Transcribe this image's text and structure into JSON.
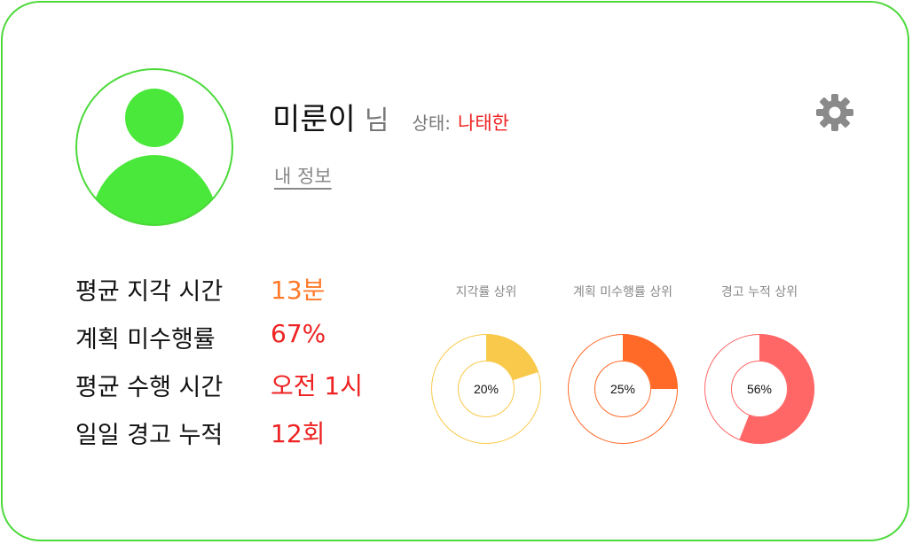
{
  "profile": {
    "name": "미룬이",
    "honorific": "님",
    "status_label": "상태:",
    "status_value": "나태한",
    "my_info_link": "내 정보",
    "avatar_icon": "user-silhouette-icon",
    "settings_icon": "gear-icon"
  },
  "stats": [
    {
      "label": "평균 지각 시간",
      "value": "13분",
      "color": "#ff7a2a"
    },
    {
      "label": "계획 미수행률",
      "value": "67%",
      "color": "#ee2222"
    },
    {
      "label": "평균 수행 시간",
      "value": "오전 1시",
      "color": "#ee2222"
    },
    {
      "label": "일일 경고 누적",
      "value": "12회",
      "color": "#ee2222"
    }
  ],
  "rankings": [
    {
      "title": "지각률 상위",
      "percent_label": "20%",
      "percent": 20,
      "color": "#f8c94a"
    },
    {
      "title": "계획 미수행률 상위",
      "percent_label": "25%",
      "percent": 25,
      "color": "#ff6a28"
    },
    {
      "title": "경고 누적 상위",
      "percent_label": "56%",
      "percent": 56,
      "color": "#ff6666"
    }
  ],
  "colors": {
    "card_border": "#4cd93a",
    "avatar_fill": "#4ae83a"
  }
}
